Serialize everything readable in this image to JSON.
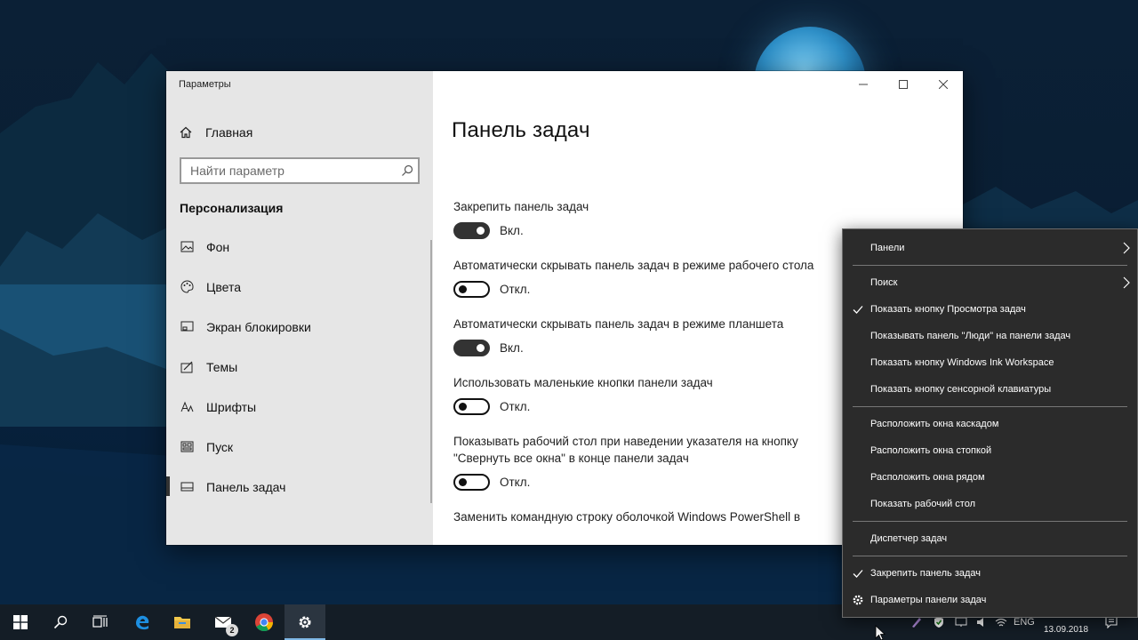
{
  "settings": {
    "window_title": "Параметры",
    "home_label": "Главная",
    "search_placeholder": "Найти параметр",
    "section": "Персонализация",
    "nav": [
      {
        "label": "Фон",
        "icon": "image-icon"
      },
      {
        "label": "Цвета",
        "icon": "palette-icon"
      },
      {
        "label": "Экран блокировки",
        "icon": "lock-screen-icon"
      },
      {
        "label": "Темы",
        "icon": "themes-icon"
      },
      {
        "label": "Шрифты",
        "icon": "fonts-icon"
      },
      {
        "label": "Пуск",
        "icon": "start-icon"
      },
      {
        "label": "Панель задач",
        "icon": "taskbar-icon"
      }
    ],
    "page_title": "Панель задач",
    "options": [
      {
        "label": "Закрепить панель задач",
        "state": "Вкл.",
        "on": true
      },
      {
        "label": "Автоматически скрывать панель задач в режиме рабочего стола",
        "state": "Откл.",
        "on": false
      },
      {
        "label": "Автоматически скрывать панель задач в режиме планшета",
        "state": "Вкл.",
        "on": true
      },
      {
        "label": "Использовать маленькие кнопки панели задач",
        "state": "Откл.",
        "on": false
      },
      {
        "label": "Показывать рабочий стол при наведении указателя на кнопку \"Свернуть все окна\" в конце панели задач",
        "state": "Откл.",
        "on": false
      },
      {
        "label": "Заменить командную строку оболочкой Windows PowerShell в"
      }
    ]
  },
  "context_menu": {
    "groups": [
      [
        {
          "label": "Панели",
          "submenu": true
        },
        {
          "label": "Поиск",
          "submenu": true
        },
        {
          "label": "Показать кнопку Просмотра задач",
          "checked": true
        },
        {
          "label": "Показывать панель \"Люди\" на панели задач"
        },
        {
          "label": "Показать кнопку Windows Ink Workspace"
        },
        {
          "label": "Показать кнопку сенсорной клавиатуры"
        }
      ],
      [
        {
          "label": "Расположить окна каскадом"
        },
        {
          "label": "Расположить окна стопкой"
        },
        {
          "label": "Расположить окна рядом"
        },
        {
          "label": "Показать рабочий стол"
        }
      ],
      [
        {
          "label": "Диспетчер задач"
        }
      ],
      [
        {
          "label": "Закрепить панель задач",
          "checked": true
        },
        {
          "label": "Параметры панели задач",
          "gear": true
        }
      ]
    ]
  },
  "taskbar": {
    "mail_badge": "2",
    "language": "ENG",
    "date": "13.09.2018"
  },
  "colors": {
    "toggle_on": "#333333",
    "menu_bg": "#2b2b2b",
    "taskbar_bg": "#141d26",
    "sidebar_bg": "#e6e6e6"
  }
}
